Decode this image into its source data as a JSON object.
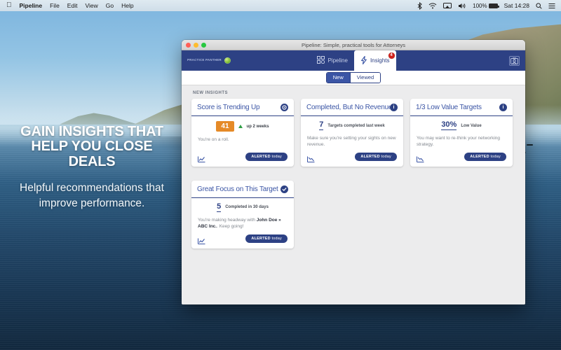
{
  "menubar": {
    "apple_icon": "apple-logo",
    "items": [
      "Pipeline",
      "File",
      "Edit",
      "View",
      "Go",
      "Help"
    ],
    "status_icons": [
      "bluetooth-icon",
      "wifi-icon",
      "airplay-icon",
      "volume-icon"
    ],
    "battery_percent": "100%",
    "clock": "Sat 14:28",
    "right_icons": [
      "search-icon",
      "notification-center-icon"
    ]
  },
  "promo": {
    "headline": "GAIN INSIGHTS THAT HELP YOU CLOSE DEALS",
    "subline": "Helpful recommendations that improve performance."
  },
  "window": {
    "title": "Pipeline: Simple, practical tools for Attorneys",
    "brand_mark": "PRACTICE PANTHER",
    "tabs": [
      {
        "label": "Pipeline",
        "icon": "grid-icon",
        "active": false,
        "badge": ""
      },
      {
        "label": "Insights",
        "icon": "lightning-bolt-icon",
        "active": true,
        "badge": "4"
      }
    ],
    "toolbar_right_icon": "id-badge-icon"
  },
  "filter": {
    "options": [
      "New",
      "Viewed"
    ],
    "selected": "New"
  },
  "section": {
    "label": "NEW INSIGHTS"
  },
  "cards": [
    {
      "title": "Score is Trending Up",
      "icon": "target-circle-icon",
      "metric_value": "41",
      "metric_style": "chip",
      "metric_label": "",
      "trend_icon": "trend-up-icon",
      "trend_text": "up 2 weeks",
      "body": "You're on a roll.",
      "body_bold": "",
      "body_tail": "",
      "foot_icon": "line-chart-up-icon",
      "badge_strong": "ALERTED",
      "badge_light": "today"
    },
    {
      "title": "Completed, But No Revenue",
      "icon": "info-circle-icon",
      "metric_value": "7",
      "metric_style": "underline",
      "metric_label": "Targets completed last week",
      "trend_icon": "",
      "trend_text": "",
      "body": "Make sure you're setting your sights on new revenue.",
      "body_bold": "",
      "body_tail": "",
      "foot_icon": "line-chart-down-icon",
      "badge_strong": "ALERTED",
      "badge_light": "today"
    },
    {
      "title": "1/3 Low Value Targets",
      "icon": "info-circle-icon",
      "metric_value": "30%",
      "metric_style": "underline",
      "metric_label": "Low Value",
      "trend_icon": "",
      "trend_text": "",
      "body": "You may want to re-think your networking strategy.",
      "body_bold": "",
      "body_tail": "",
      "foot_icon": "line-chart-down-icon",
      "badge_strong": "ALERTED",
      "badge_light": "today"
    },
    {
      "title": "Great Focus on This Target",
      "icon": "check-circle-icon",
      "metric_value": "5",
      "metric_style": "underline",
      "metric_label": "Completed in 30 days",
      "trend_icon": "",
      "trend_text": "",
      "body": "You're making headway with ",
      "body_bold": "John Doe » ABC Inc.",
      "body_tail": ". Keep going!",
      "foot_icon": "line-chart-up-icon",
      "badge_strong": "ALERTED",
      "badge_light": "today"
    }
  ],
  "colors": {
    "brand_navy": "#2d4184",
    "brand_blue": "#3b55a5",
    "accent_orange": "#e58a27",
    "trend_green": "#2f9e44",
    "badge_red": "#d0211c"
  }
}
